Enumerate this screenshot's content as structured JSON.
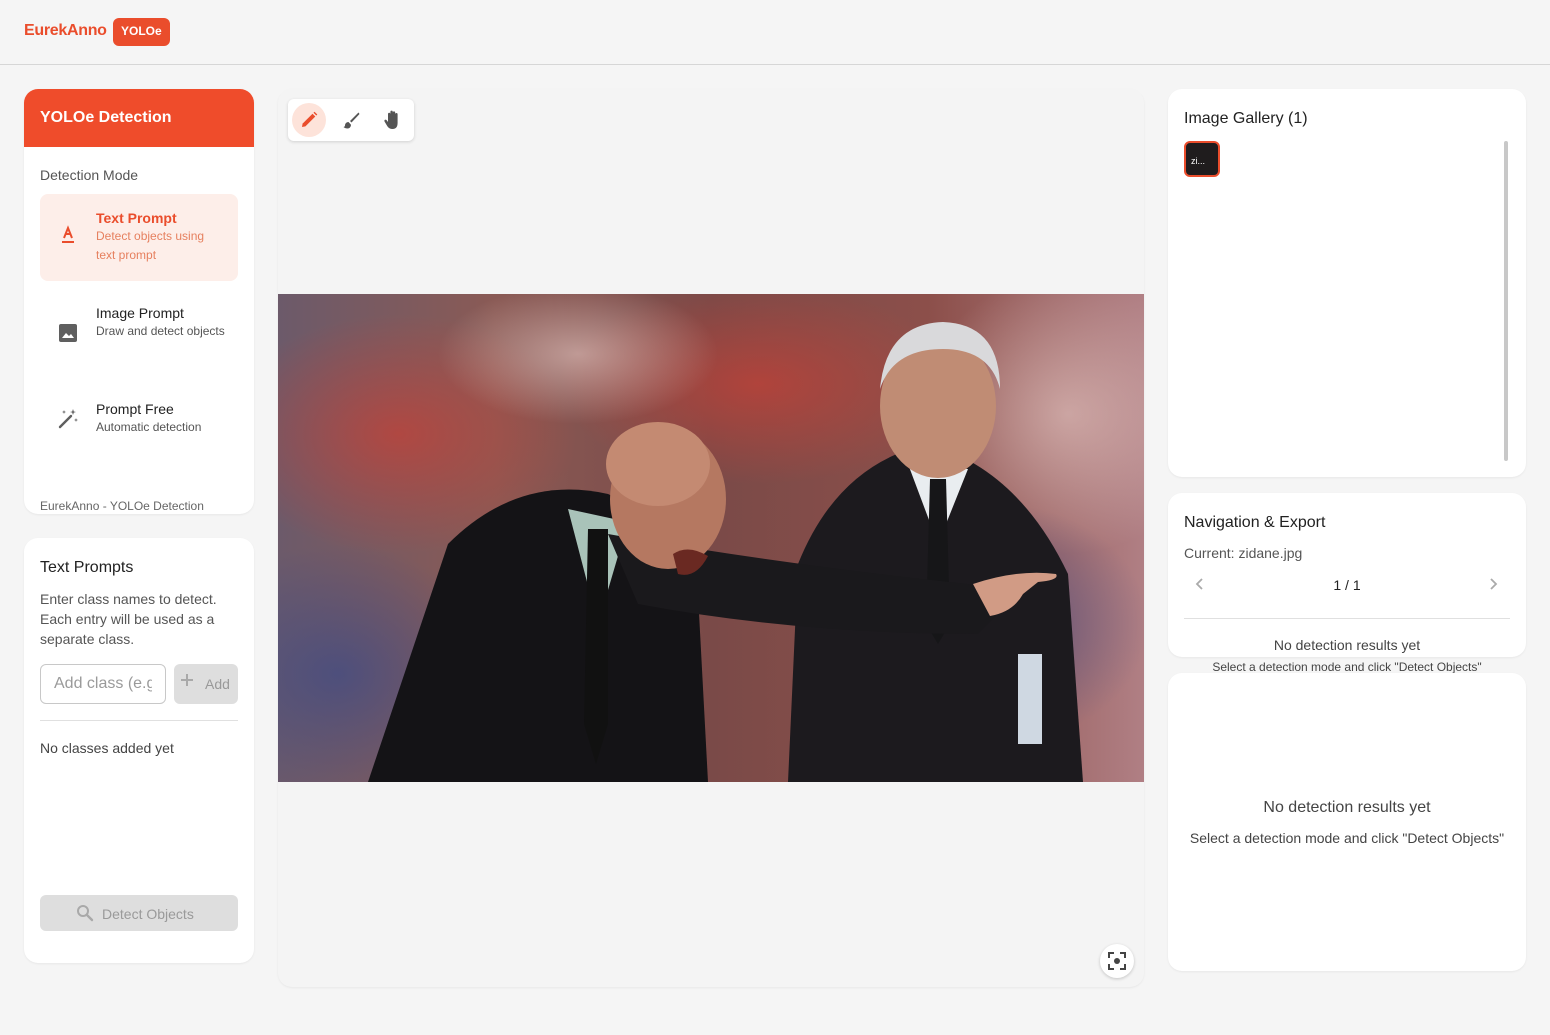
{
  "app": {
    "brand": "EurekAnno",
    "badge": "YOLOe"
  },
  "mode_panel": {
    "title": "YOLOe Detection",
    "section_label": "Detection Mode",
    "modes": [
      {
        "title": "Text Prompt",
        "desc": "Detect objects using text prompt",
        "icon": "text-format-icon",
        "active": true
      },
      {
        "title": "Image Prompt",
        "desc": "Draw and detect objects",
        "icon": "image-icon",
        "active": false
      },
      {
        "title": "Prompt Free",
        "desc": "Automatic detection",
        "icon": "magic-wand-icon",
        "active": false
      }
    ],
    "footer": "EurekAnno - YOLOe Detection"
  },
  "prompts": {
    "title": "Text Prompts",
    "help": "Enter class names to detect. Each entry will be used as a separate class.",
    "input_placeholder": "Add class (e.g. person)",
    "input_value": "",
    "add_label": "Add",
    "empty": "No classes added yet",
    "detect_label": "Detect Objects"
  },
  "canvas": {
    "tools": [
      {
        "icon": "pencil-icon",
        "active": true
      },
      {
        "icon": "brush-icon",
        "active": false
      },
      {
        "icon": "hand-icon",
        "active": false
      }
    ],
    "fit_icon": "fit-view-icon"
  },
  "gallery": {
    "title": "Image Gallery (1)",
    "thumbs": [
      {
        "label": "zi..."
      }
    ]
  },
  "navigation": {
    "title": "Navigation & Export",
    "current": "Current: zidane.jpg",
    "page": "1 / 1",
    "empty": "No detection results yet",
    "sub": "Select a detection mode and click \"Detect Objects\""
  },
  "results": {
    "title": "No detection results yet",
    "sub": "Select a detection mode and click \"Detect Objects\""
  },
  "colors": {
    "accent": "#ea4d2c",
    "accent_light": "#fdeee9"
  }
}
